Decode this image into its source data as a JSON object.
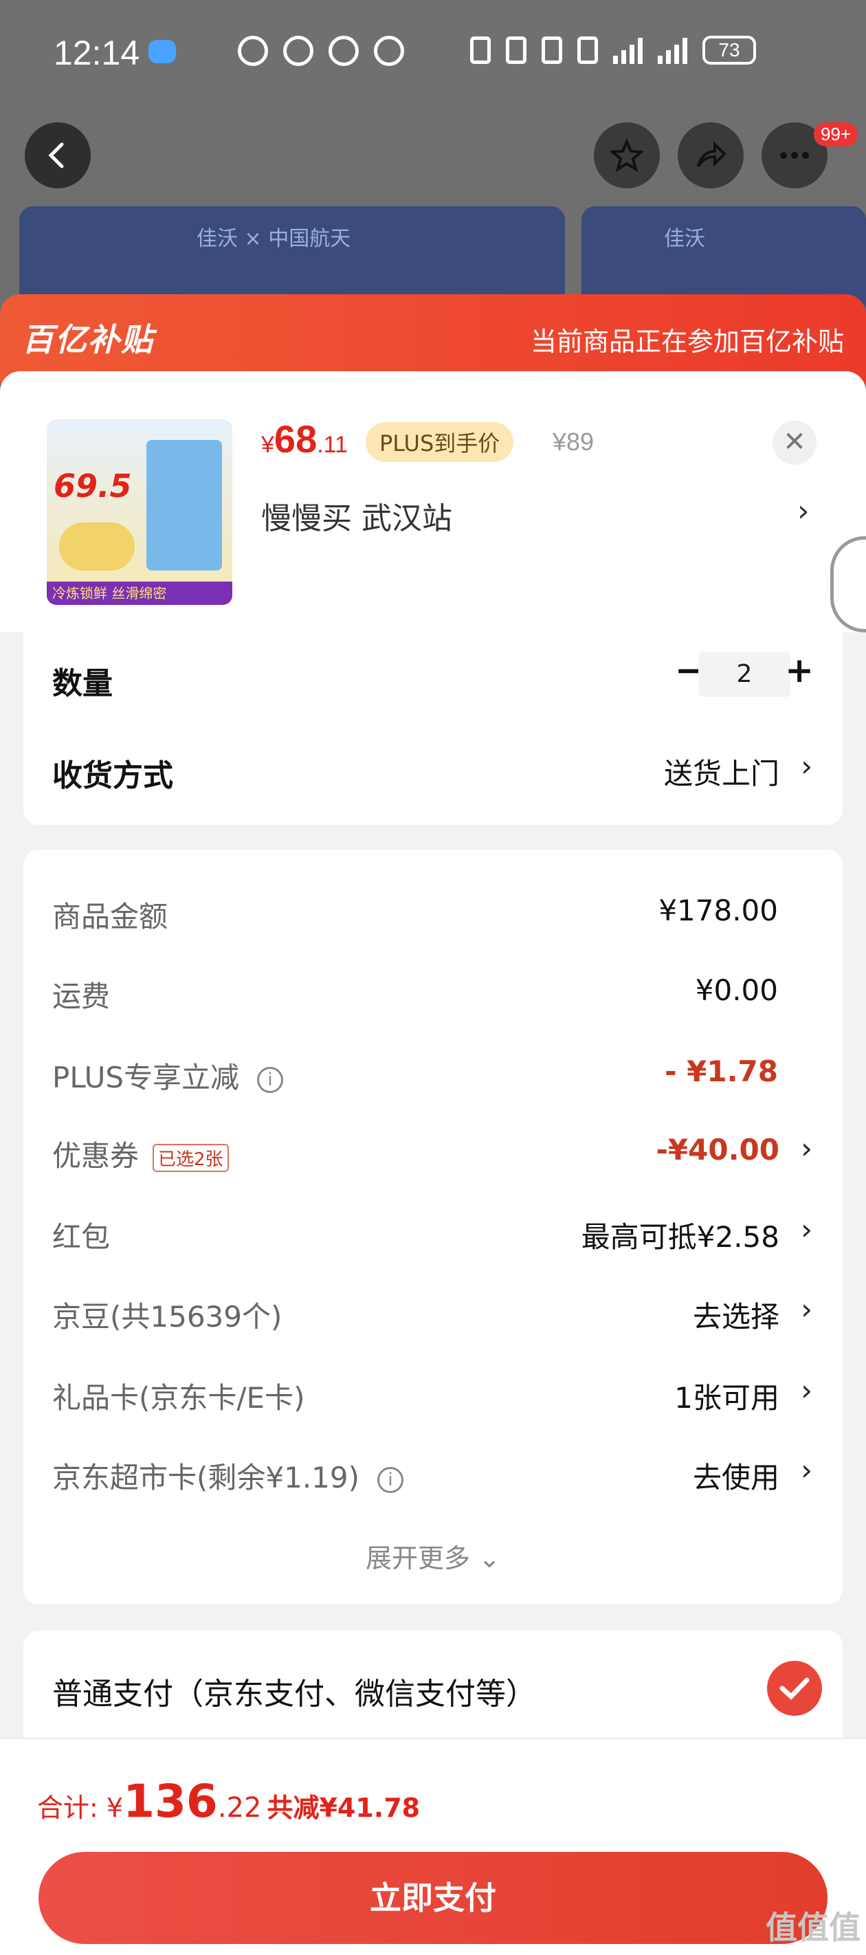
{
  "status_bar": {
    "time": "12:14",
    "battery": "73"
  },
  "nav": {
    "badge": "99+"
  },
  "banner": {
    "brand": "佳沃 × 中国航天",
    "brand2": "佳沃"
  },
  "subsidy": {
    "logo": "百亿补贴",
    "note": "当前商品正在参加百亿补贴"
  },
  "product": {
    "price_symbol": "¥",
    "price_int": "68",
    "price_dec": ".11",
    "plus_tag": "PLUS到手价",
    "original_price": "¥89",
    "store": "慢慢买  武汉站",
    "thumb_price": "69.5",
    "thumb_footer": "冷炼锁鲜 丝滑绵密"
  },
  "options": {
    "quantity_label": "数量",
    "quantity_value": "2",
    "delivery_label": "收货方式",
    "delivery_value": "送货上门"
  },
  "costs": [
    {
      "label": "商品金额",
      "value": "¥178.00"
    },
    {
      "label": "运费",
      "value": "¥0.00"
    },
    {
      "label": "PLUS专享立减",
      "value": "- ¥1.78"
    },
    {
      "label": "优惠券",
      "tag": "已选2张",
      "value": "-¥40.00"
    },
    {
      "label": "红包",
      "value": "最高可抵¥2.58"
    },
    {
      "label": "京豆(共15639个)",
      "value": "去选择"
    },
    {
      "label": "礼品卡(京东卡/E卡)",
      "value": "1张可用"
    },
    {
      "label": "京东超市卡(剩余¥1.19)",
      "value": "去使用"
    }
  ],
  "expand_more": "展开更多",
  "payment": {
    "method": "普通支付（京东支付、微信支付等）"
  },
  "footer": {
    "total_label": "合计: ¥",
    "total_int": "136",
    "total_dec": ".22",
    "saved": "共减¥41.78",
    "pay_button": "立即支付"
  },
  "watermark": "值值值",
  "colors": {
    "accent": "#e2231a",
    "subsidy": "#ef5a36"
  }
}
